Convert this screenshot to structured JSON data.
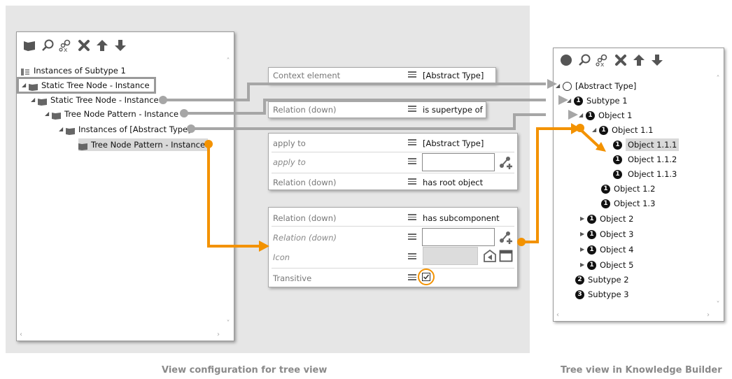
{
  "left_tree": {
    "items": [
      {
        "label": "Instances of Subtype 1"
      },
      {
        "label": "Static Tree Node - Instance"
      },
      {
        "label": "Static Tree Node - Instance"
      },
      {
        "label": "Tree Node Pattern - Instance"
      },
      {
        "label": "Instances of [Abstract Type]"
      },
      {
        "label": "Tree Node Pattern - Instance"
      }
    ]
  },
  "config": {
    "context": {
      "label": "Context element",
      "value": "[Abstract Type]"
    },
    "relation1": {
      "label": "Relation (down)",
      "value": "is supertype of"
    },
    "block1": {
      "apply_to_label": "apply to",
      "apply_to_value": "[Abstract Type]",
      "apply_to_italic_label": "apply to",
      "relation_label": "Relation (down)",
      "relation_value": "has root object"
    },
    "block2": {
      "relation_label": "Relation (down)",
      "relation_value": "has subcomponent",
      "relation_italic_label": "Relation (down)",
      "icon_label": "Icon",
      "transitive_label": "Transitive",
      "transitive_checked": true
    }
  },
  "right_tree": {
    "items": [
      {
        "label": "[Abstract Type]",
        "badge": ""
      },
      {
        "label": "Subtype 1",
        "badge": "1"
      },
      {
        "label": "Object 1",
        "badge": "1"
      },
      {
        "label": "Object 1.1",
        "badge": "1"
      },
      {
        "label": "Object 1.1.1",
        "badge": "1"
      },
      {
        "label": "Object 1.1.2",
        "badge": "1"
      },
      {
        "label": "Object 1.1.3",
        "badge": "1"
      },
      {
        "label": "Object 1.2",
        "badge": "1"
      },
      {
        "label": "Object 1.3",
        "badge": "1"
      },
      {
        "label": "Object 2",
        "badge": "1"
      },
      {
        "label": "Object 3",
        "badge": "1"
      },
      {
        "label": "Object 4",
        "badge": "1"
      },
      {
        "label": "Object 5",
        "badge": "1"
      },
      {
        "label": "Subtype 2",
        "badge": "2"
      },
      {
        "label": "Subtype 3",
        "badge": "3"
      }
    ]
  },
  "captions": {
    "left": "View configuration for tree view",
    "right": "Tree view in Knowledge Builder"
  },
  "colors": {
    "accent_orange": "#f39200",
    "connector_gray": "#a6a6a6",
    "selected_bg": "#d9d9d9"
  }
}
